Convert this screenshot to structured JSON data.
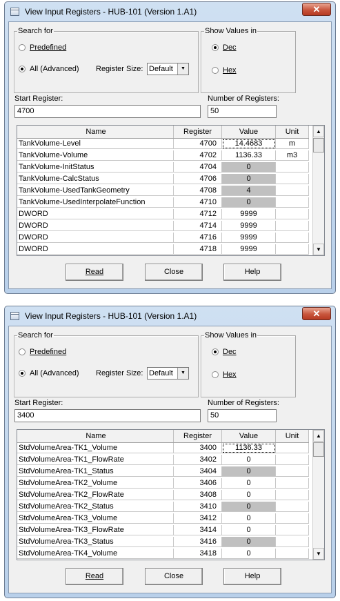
{
  "dialogs": [
    {
      "title": "View Input Registers - HUB-101 (Version 1.A1)",
      "close_glyph": "✕",
      "search_group_label": "Search for",
      "predefined_label": "Predefined",
      "all_label": "All (Advanced)",
      "register_size_label": "Register Size:",
      "register_size_value": "Default",
      "show_values_label": "Show Values in",
      "dec_label": "Dec",
      "hex_label": "Hex",
      "start_register_label": "Start Register:",
      "start_register_value": "4700",
      "num_registers_label": "Number of Registers:",
      "num_registers_value": "50",
      "columns": [
        "Name",
        "Register",
        "Value",
        "Unit"
      ],
      "rows": [
        {
          "name": "TankVolume-Level",
          "register": "4700",
          "value": "14.4683",
          "unit": "m"
        },
        {
          "name": "TankVolume-Volume",
          "register": "4702",
          "value": "1136.33",
          "unit": "m3"
        },
        {
          "name": "TankVolume-InitStatus",
          "register": "4704",
          "value": "0",
          "unit": ""
        },
        {
          "name": "TankVolume-CalcStatus",
          "register": "4706",
          "value": "0",
          "unit": ""
        },
        {
          "name": "TankVolume-UsedTankGeometry",
          "register": "4708",
          "value": "4",
          "unit": ""
        },
        {
          "name": "TankVolume-UsedInterpolateFunction",
          "register": "4710",
          "value": "0",
          "unit": ""
        },
        {
          "name": "DWORD",
          "register": "4712",
          "value": "9999",
          "unit": ""
        },
        {
          "name": "DWORD",
          "register": "4714",
          "value": "9999",
          "unit": ""
        },
        {
          "name": "DWORD",
          "register": "4716",
          "value": "9999",
          "unit": ""
        },
        {
          "name": "DWORD",
          "register": "4718",
          "value": "9999",
          "unit": ""
        }
      ],
      "read_label": "Read",
      "close_label": "Close",
      "help_label": "Help"
    },
    {
      "title": "View Input Registers - HUB-101 (Version 1.A1)",
      "close_glyph": "✕",
      "search_group_label": "Search for",
      "predefined_label": "Predefined",
      "all_label": "All (Advanced)",
      "register_size_label": "Register Size:",
      "register_size_value": "Default",
      "show_values_label": "Show Values in",
      "dec_label": "Dec",
      "hex_label": "Hex",
      "start_register_label": "Start Register:",
      "start_register_value": "3400",
      "num_registers_label": "Number of Registers:",
      "num_registers_value": "50",
      "columns": [
        "Name",
        "Register",
        "Value",
        "Unit"
      ],
      "rows": [
        {
          "name": "StdVolumeArea-TK1_Volume",
          "register": "3400",
          "value": "1136.33",
          "unit": ""
        },
        {
          "name": "StdVolumeArea-TK1_FlowRate",
          "register": "3402",
          "value": "0",
          "unit": ""
        },
        {
          "name": "StdVolumeArea-TK1_Status",
          "register": "3404",
          "value": "0",
          "unit": ""
        },
        {
          "name": "StdVolumeArea-TK2_Volume",
          "register": "3406",
          "value": "0",
          "unit": ""
        },
        {
          "name": "StdVolumeArea-TK2_FlowRate",
          "register": "3408",
          "value": "0",
          "unit": ""
        },
        {
          "name": "StdVolumeArea-TK2_Status",
          "register": "3410",
          "value": "0",
          "unit": ""
        },
        {
          "name": "StdVolumeArea-TK3_Volume",
          "register": "3412",
          "value": "0",
          "unit": ""
        },
        {
          "name": "StdVolumeArea-TK3_FlowRate",
          "register": "3414",
          "value": "0",
          "unit": ""
        },
        {
          "name": "StdVolumeArea-TK3_Status",
          "register": "3416",
          "value": "0",
          "unit": ""
        },
        {
          "name": "StdVolumeArea-TK4_Volume",
          "register": "3418",
          "value": "0",
          "unit": ""
        }
      ],
      "read_label": "Read",
      "close_label": "Close",
      "help_label": "Help"
    }
  ],
  "readonly_rows": [
    [
      2,
      3,
      4,
      5
    ],
    [
      2,
      5,
      8
    ]
  ],
  "colors": {
    "readonly_cell": "#c0c0c0",
    "title_close": "#c8563d",
    "frame": "#b9d0ea"
  },
  "icons": {
    "window": "dialog-window-icon",
    "close": "close-icon",
    "scroll_up": "scroll-up-arrow-icon",
    "scroll_down": "scroll-down-arrow-icon",
    "dropdown": "dropdown-arrow-icon"
  }
}
